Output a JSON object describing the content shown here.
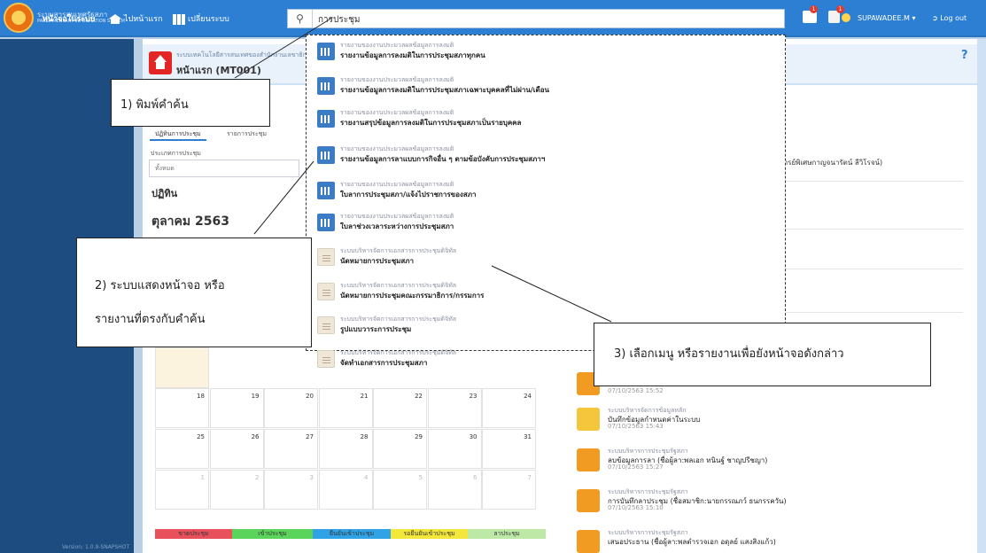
{
  "brand": {
    "line1": "ระบบสารสนเทศรัฐสภา",
    "line2": "PARLIAMENTARY INFORMATION SYSTEM"
  },
  "nav": {
    "home": "ไปหน้าแรก",
    "switch": "เปลี่ยนระบบ"
  },
  "search": {
    "value": "การประชุม",
    "icon": "search-icon"
  },
  "header_right": {
    "user": "SUPAWADEE.M ▾",
    "logout": "Log out",
    "badge_mail": "1",
    "badge_doc": "1"
  },
  "sidebar": {
    "item": "หน้าจอในระบบ",
    "version": "Version: 1.0.9-SNAPSHOT"
  },
  "page": {
    "system_sub": "ระบบเทคโนโลยีสารสนเทศของสำนักงานเลขาธิการรัฐสภา",
    "title": "หน้าแรก (MT001)",
    "help": "?"
  },
  "main": {
    "tabs": [
      "ปฏิทินการประชุม",
      "รายการประชุม"
    ],
    "filter_label": "ประเภทการประชุม",
    "filter_value": "ทั้งหมด",
    "section": "ปฏิทิน",
    "month": "ตุลาคม 2563",
    "right_text": "จารย์พิเศษกาญจนารัตน์ ลีวิโรจน์)"
  },
  "callouts": {
    "c1": "1) พิมพ์คำค้น",
    "c2a": "2) ระบบแสดงหน้าจอ หรือ",
    "c2b": "รายงานที่ตรงกับคำค้น",
    "c3": "3) เลือกเมนู หรือรายงานเพื่อยังหน้าจอดังกล่าว"
  },
  "dropdown": [
    {
      "cat": "รายงานของงานประมวลผลข้อมูลการลงมติ",
      "name": "รายงานข้อมูลการลงมติในการประชุมสภาทุกคน",
      "icon": "chart"
    },
    {
      "cat": "รายงานของงานประมวลผลข้อมูลการลงมติ",
      "name": "รายงานข้อมูลการลงมติในการประชุมสภาเฉพาะบุคคลที่ไม่ผ่าน/เดือน",
      "icon": "chart"
    },
    {
      "cat": "รายงานของงานประมวลผลข้อมูลการลงมติ",
      "name": "รายงานสรุปข้อมูลการลงมติในการประชุมสภาเป็นรายบุคคล",
      "icon": "chart"
    },
    {
      "cat": "รายงานของงานประมวลผลข้อมูลการลงมติ",
      "name": "รายงานข้อมูลการลาแบบการกิจอื่น ๆ ตามข้อบังคับการประชุมสภาฯ",
      "icon": "chart"
    },
    {
      "cat": "รายงานของงานประมวลผลข้อมูลการลงมติ",
      "name": "ใบลาการประชุมสภา/แจ้งไปราชการของสภา",
      "icon": "chart"
    },
    {
      "cat": "รายงานของงานประมวลผลข้อมูลการลงมติ",
      "name": "ใบลาช่วงเวลาระหว่างการประชุมสภา",
      "icon": "chart"
    },
    {
      "cat": "ระบบบริหารจัดการเอกสารการประชุมดิจิทัล",
      "name": "นัดหมายการประชุมสภา",
      "icon": "doc"
    },
    {
      "cat": "ระบบบริหารจัดการเอกสารการประชุมดิจิทัล",
      "name": "นัดหมายการประชุมคณะกรรมาธิการ/กรรมการ",
      "icon": "doc"
    },
    {
      "cat": "ระบบบริหารจัดการเอกสารการประชุมดิจิทัล",
      "name": "รูปแบบวาระการประชุม",
      "icon": "doc"
    },
    {
      "cat": "ระบบบริหารจัดการเอกสารการประชุมดิจิทัล",
      "name": "จัดทำเอกสารการประชุมสภา",
      "icon": "doc"
    }
  ],
  "calendar": {
    "row1": [
      "18",
      "19",
      "20",
      "21",
      "22",
      "23",
      "24"
    ],
    "row2": [
      "25",
      "26",
      "27",
      "28",
      "29",
      "30",
      "31"
    ],
    "row3": [
      "1",
      "2",
      "3",
      "4",
      "5",
      "6",
      "7"
    ]
  },
  "legend": [
    {
      "label": "ขาดประชุม",
      "color": "#e8505b"
    },
    {
      "label": "เข้าประชุม",
      "color": "#5ad45a"
    },
    {
      "label": "ยืนยันเข้าประชุม",
      "color": "#2fa3e6"
    },
    {
      "label": "รอยืนยันเข้าประชุม",
      "color": "#f2e73a"
    },
    {
      "label": "ลาประชุม",
      "color": "#bde8a6"
    }
  ],
  "activities": [
    {
      "cat": "",
      "title": "",
      "time": "07/10/2563 15:52"
    },
    {
      "cat": "ระบบบริหารจัดการข้อมูลหลัก",
      "title": "บันทึกข้อมูลกำหนดค่าในระบบ",
      "time": "07/10/2563 15:43"
    },
    {
      "cat": "ระบบบริหารการประชุมรัฐสภา",
      "title": "ลบข้อมูลการลา (ชื่อผู้ลา:พลเอก ทนินฐ์ ชาญปรีชญา)",
      "time": "07/10/2563 15:27"
    },
    {
      "cat": "ระบบบริหารการประชุมรัฐสภา",
      "title": "การบันทึกลาประชุม (ชื่อสมาชิก:นายกรรณภว์ ธนกรรควัน)",
      "time": "07/10/2563 15:10"
    },
    {
      "cat": "ระบบบริหารการประชุมรัฐสภา",
      "title": "เสนอประธาน (ชื่อผู้ลา:พลตำรวจเอก อดุลย์ แสงสิงแก้ว)",
      "time": ""
    }
  ]
}
